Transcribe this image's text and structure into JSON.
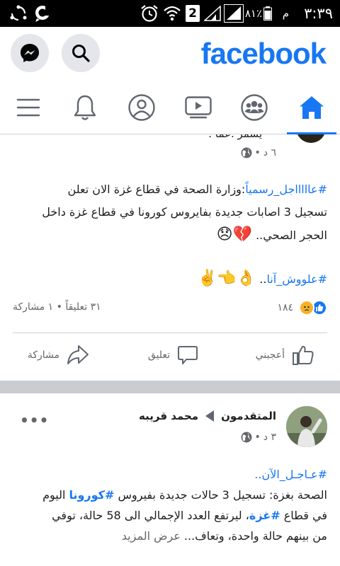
{
  "status_bar": {
    "time": "٣:٣٩",
    "ampm": "م",
    "battery_pct": "٨١٪",
    "sim_label": "2"
  },
  "header": {
    "logo": "facebook",
    "icons": [
      "search-icon",
      "messenger-icon"
    ]
  },
  "nav": {
    "tabs": [
      "home-icon",
      "groups-icon",
      "watch-icon",
      "profile-icon",
      "bell-icon",
      "menu-icon"
    ],
    "active": "home-icon",
    "accent": "#1877f2"
  },
  "post1": {
    "author_clipped": "يسمر .عما .",
    "time": "٦ د",
    "dot": "•",
    "line1_tag": "#عاااااجل_رسمياً",
    "line1_rest": ":وزارة الصحة في قطاع غزة الان تعلن",
    "line2": "تسجيل 3 اصابات جديدة بفايروس كورونا في قطاع غزة داخل",
    "line3": "الحجر الصحي..",
    "emoji1": "💔😞",
    "line4_tag": "#علووش_آنا",
    "line4_rest": "..",
    "emoji2": "👌👈✌️",
    "reactions_count": "١٨٤",
    "comments_shares": "٣١ تعليقاً • ١ مشاركة"
  },
  "actions": {
    "like": "أعجبني",
    "comment": "تعليق",
    "share": "مشاركة"
  },
  "post2": {
    "author": "محمد قريبه",
    "group": "المتقدمون",
    "time": "٣ د",
    "dot": "•",
    "more": "•••",
    "line1": "#عـاجـل_الآن..",
    "line2a": "الصحة بغزة: تسجيل 3 حالات جديدة بفيروس ",
    "line2_tag": "#كورونا",
    "line2b": " اليوم",
    "line3a": "في قطاع ",
    "line3_tag": "#غزة",
    "line3b": "، ليرتفع العدد الإجمالي الى 58 حالة، توفي",
    "line4": "من بينهم حالة واحدة، وتعاف...",
    "see_more": "عرض المزيد"
  }
}
